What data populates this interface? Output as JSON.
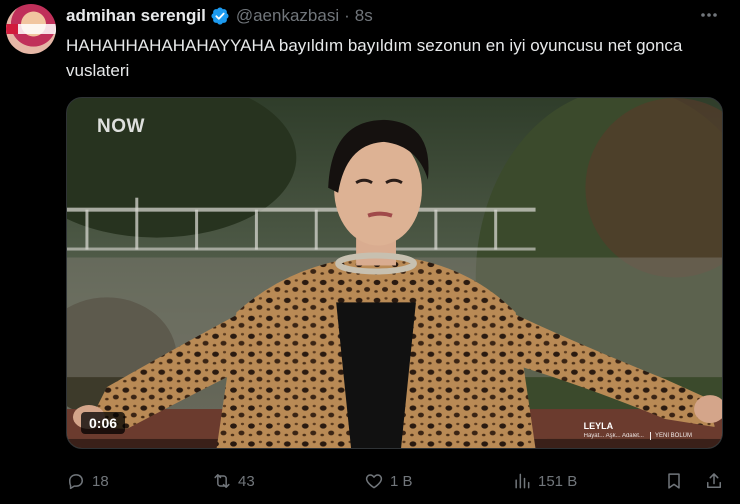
{
  "tweet": {
    "author_name": "admihan serengil",
    "handle": "@aenkazbasi",
    "separator": "·",
    "time": "8s",
    "text": "HAHAHHAHAHAHAYYAHA bayıldım bayıldım sezonun en iyi oyuncusu net gonca vuslateri",
    "more_icon": "more-horizontal-icon"
  },
  "video": {
    "watermark": "NOW",
    "duration": "0:06",
    "show_title": "LEYLA",
    "show_subtitle": "Hayat... Aşk... Adalet...",
    "show_tag": "YENİ BÖLÜM"
  },
  "actions": {
    "replies": "18",
    "reposts": "43",
    "likes": "1 B",
    "views": "151 B"
  },
  "colors": {
    "background": "#000000",
    "text": "#e7e9ea",
    "muted": "#71767b",
    "verified": "#1d9bf0"
  }
}
